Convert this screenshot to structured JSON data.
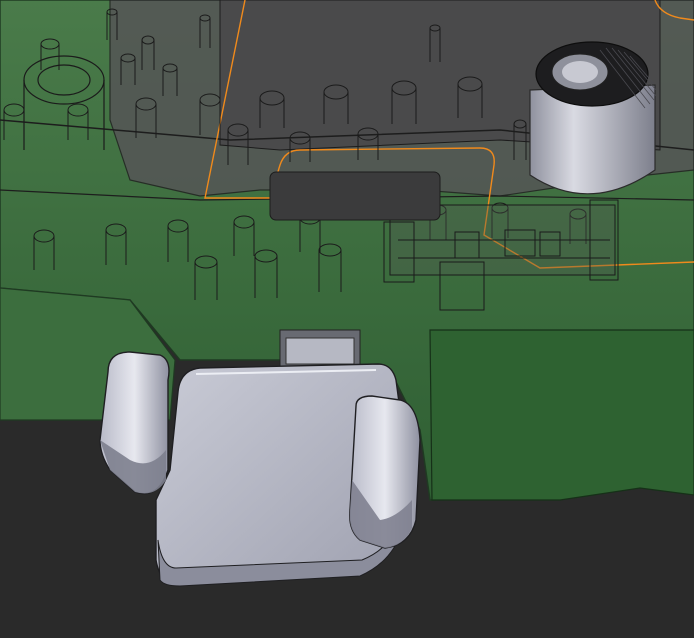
{
  "viewport": {
    "background": "#2a2a2a",
    "pcb_color": "#3d6b3f",
    "pcb_dark": "#2f5a32",
    "housing_color": "#4a4a4a",
    "outline_color": "#f08a1c",
    "component_color": "#a7a9b8",
    "pin_color": "#9aa8a0"
  }
}
